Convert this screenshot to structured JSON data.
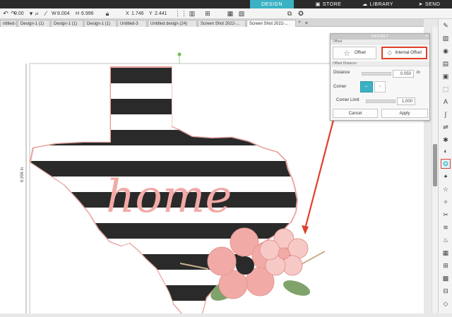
{
  "nav": {
    "design": "DESIGN",
    "store": "STORE",
    "library": "LIBRARY",
    "send": "SEND"
  },
  "toolbar": {
    "rotate_value": "0.00",
    "rotate_unit": "pt",
    "w_label": "W",
    "w_value": "8.004",
    "h_label": "H",
    "h_value": "6.996",
    "x_label": "X",
    "x_value": "1.746",
    "y_label": "Y",
    "y_value": "2.441"
  },
  "tabs": [
    "ntitled-2",
    "Design-1 (1)",
    "Design-1 (1)",
    "Design-1 (1)",
    "Untitled-3",
    "Untitled design (24)",
    "Screen Shot 2022-...",
    "Screen Shot 2022-..."
  ],
  "canvas": {
    "dimension_label": "6.996 in",
    "artwork_text": "home"
  },
  "offset_panel": {
    "title": "OFFSET",
    "section_offset": "Offset",
    "offset_label": "Offset",
    "internal_offset_label": "Internal Offset",
    "section_distance": "Offset Distance",
    "distance_label": "Distance",
    "distance_value": "0.050",
    "distance_unit": "in",
    "corner_label": "Corner",
    "corner_limit_label": "Corner Limit",
    "corner_limit_value": "1.000",
    "cancel_label": "Cancel",
    "apply_label": "Apply"
  },
  "colors": {
    "accent_teal": "#3bb2c4",
    "highlight_red": "#e0402a",
    "texas_black": "#2a2a2a",
    "pink": "#f2aaa6",
    "leaf_green": "#7fa36a",
    "outline_pink": "#f3b9b5"
  }
}
